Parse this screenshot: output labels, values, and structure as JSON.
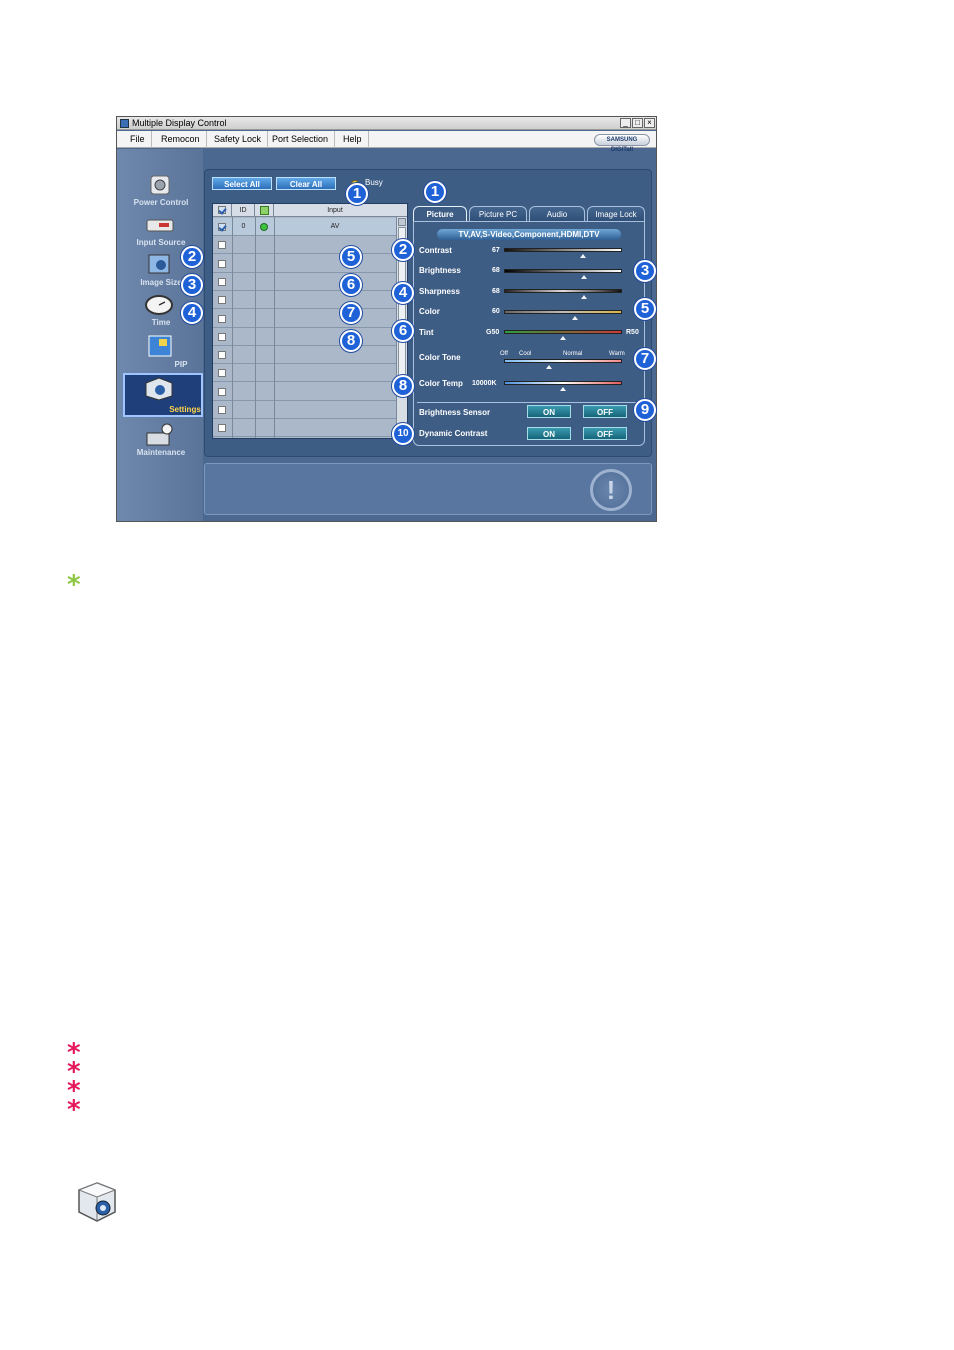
{
  "window": {
    "title": "Multiple Display Control",
    "min": "_",
    "max": "□",
    "close": "×",
    "brand": "SAMSUNG DIGITall"
  },
  "menu": [
    "File",
    "Remocon",
    "Safety Lock",
    "Port Selection",
    "Help"
  ],
  "sidebar": [
    {
      "label": "Power Control"
    },
    {
      "label": "Input Source"
    },
    {
      "label": "Image Size"
    },
    {
      "label": "Time"
    },
    {
      "label": "PIP"
    },
    {
      "label": "Settings",
      "active": true
    },
    {
      "label": "Maintenance"
    }
  ],
  "toolbar": {
    "select_all": "Select All",
    "clear_all": "Clear All",
    "busy": "Busy"
  },
  "grid": {
    "headers": {
      "id": "ID",
      "input": "Input"
    },
    "rows": [
      {
        "checked": true,
        "id": "0",
        "input": "AV"
      },
      {
        "checked": false,
        "id": "",
        "input": ""
      },
      {
        "checked": false,
        "id": "",
        "input": ""
      },
      {
        "checked": false,
        "id": "",
        "input": ""
      },
      {
        "checked": false,
        "id": "",
        "input": ""
      },
      {
        "checked": false,
        "id": "",
        "input": ""
      },
      {
        "checked": false,
        "id": "",
        "input": ""
      },
      {
        "checked": false,
        "id": "",
        "input": ""
      },
      {
        "checked": false,
        "id": "",
        "input": ""
      },
      {
        "checked": false,
        "id": "",
        "input": ""
      },
      {
        "checked": false,
        "id": "",
        "input": ""
      },
      {
        "checked": false,
        "id": "",
        "input": ""
      }
    ]
  },
  "tabs": [
    "Picture",
    "Picture PC",
    "Audio",
    "Image Lock"
  ],
  "sources": "TV,AV,S-Video,Component,HDMI,DTV",
  "sliders": {
    "contrast": {
      "label": "Contrast",
      "value": "67",
      "level": 67
    },
    "brightness": {
      "label": "Brightness",
      "value": "68",
      "level": 68
    },
    "sharpness": {
      "label": "Sharpness",
      "value": "68",
      "level": 68
    },
    "color": {
      "label": "Color",
      "value": "60",
      "level": 60
    },
    "tint": {
      "label": "Tint",
      "value": "G50",
      "right": "R50",
      "level": 50
    },
    "color_tone": {
      "label": "Color Tone",
      "level": 38,
      "ticks": [
        "Off",
        "Cool",
        "Normal",
        "Warm"
      ]
    },
    "color_temp": {
      "label": "Color Temp",
      "value": "10000K",
      "level": 50
    }
  },
  "toggles": {
    "brightness_sensor": {
      "label": "Brightness Sensor",
      "on": "ON",
      "off": "OFF"
    },
    "dynamic_contrast": {
      "label": "Dynamic Contrast",
      "on": "ON",
      "off": "OFF"
    }
  },
  "alert_glyph": "!",
  "markers": {
    "one": "1",
    "two": "2",
    "three": "3",
    "four": "4",
    "five": "5",
    "six": "6",
    "seven": "7",
    "eight": "8",
    "nine": "9",
    "ten": "10"
  },
  "asterisk": "*",
  "colors": {
    "green": "#8cc63f",
    "pink": "#e5185b",
    "marker": "#1f62d8"
  }
}
